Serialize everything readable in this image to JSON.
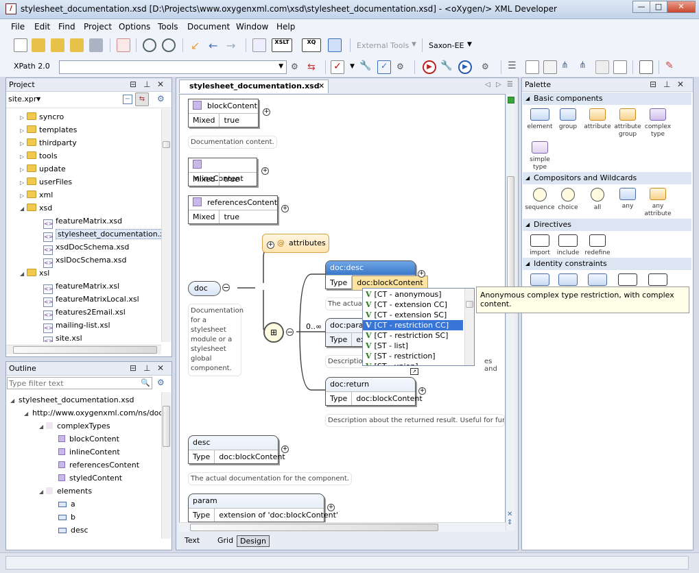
{
  "window": {
    "title": "stylesheet_documentation.xsd [D:\\Projects\\www.oxygenxml.com\\xsd\\stylesheet_documentation.xsd] - <oXygen/> XML Developer",
    "min": "—",
    "max": "□",
    "close": "✕"
  },
  "menu": [
    "File",
    "Edit",
    "Find",
    "Project",
    "Options",
    "Tools",
    "Document",
    "Window",
    "Help"
  ],
  "toolbar": {
    "external_tools": "External Tools",
    "transformer": "Saxon-EE",
    "xpath_version": "XPath 2.0",
    "xpath_value": ""
  },
  "project": {
    "title": "Project",
    "file": "site.xpr",
    "items": [
      {
        "label": "syncro",
        "kind": "folder"
      },
      {
        "label": "templates",
        "kind": "folder"
      },
      {
        "label": "thirdparty",
        "kind": "folder"
      },
      {
        "label": "tools",
        "kind": "folder"
      },
      {
        "label": "update",
        "kind": "folder"
      },
      {
        "label": "userFiles",
        "kind": "folder"
      },
      {
        "label": "xml",
        "kind": "folder"
      },
      {
        "label": "xsd",
        "kind": "folder-open"
      },
      {
        "label": "featureMatrix.xsd",
        "kind": "file"
      },
      {
        "label": "stylesheet_documentation.xsd",
        "kind": "file-selected"
      },
      {
        "label": "xsdDocSchema.xsd",
        "kind": "file"
      },
      {
        "label": "xslDocSchema.xsd",
        "kind": "file"
      },
      {
        "label": "xsl",
        "kind": "folder-open"
      },
      {
        "label": "featureMatrix.xsl",
        "kind": "file"
      },
      {
        "label": "featureMatrixLocal.xsl",
        "kind": "file"
      },
      {
        "label": "features2Email.xsl",
        "kind": "file"
      },
      {
        "label": "mailing-list.xsl",
        "kind": "file"
      },
      {
        "label": "site.xsl",
        "kind": "file"
      }
    ]
  },
  "outline": {
    "title": "Outline",
    "filter_placeholder": "Type filter text",
    "items": [
      {
        "label": "stylesheet_documentation.xsd"
      },
      {
        "label": "http://www.oxygenxml.com/ns/doc/xs"
      },
      {
        "label": "complexTypes"
      },
      {
        "label": "blockContent"
      },
      {
        "label": "inlineContent"
      },
      {
        "label": "referencesContent"
      },
      {
        "label": "styledContent"
      },
      {
        "label": "elements"
      },
      {
        "label": "a"
      },
      {
        "label": "b"
      },
      {
        "label": "desc"
      }
    ]
  },
  "editor": {
    "tab": "stylesheet_documentation.xsd",
    "nodes": {
      "block": {
        "name": "blockContent",
        "k": "Mixed",
        "v": "true",
        "doc": "Documentation content."
      },
      "inline": {
        "name": "inlineContent",
        "k": "Mixed",
        "v": "true"
      },
      "refs": {
        "name": "referencesContent",
        "k": "Mixed",
        "v": "true"
      },
      "attributes": "attributes",
      "doc": {
        "name": "doc",
        "note": "Documentation for a stylesheet module or a stylesheet global component."
      },
      "docdesc": {
        "name": "doc:desc",
        "k": "Type",
        "v": "doc:blockContent",
        "note": "The actual"
      },
      "docparam": {
        "name": "doc:param",
        "k": "Type",
        "v": "ex",
        "note": "Description",
        "note_right": "es and"
      },
      "occurs": "0..∞",
      "docreturn": {
        "name": "doc:return",
        "k": "Type",
        "v": "doc:blockContent",
        "note": "Description about the returned result. Useful for func"
      },
      "desc": {
        "name": "desc",
        "k": "Type",
        "v": "doc:blockContent",
        "note": "The actual documentation for the component."
      },
      "param": {
        "name": "param",
        "k": "Type",
        "v": "extension of 'doc:blockContent'"
      }
    },
    "autocomplete": [
      "[CT - anonymous]",
      "[CT - extension CC]",
      "[CT - extension SC]",
      "[CT - restriction CC]",
      "[CT - restriction SC]",
      "[ST - list]",
      "[ST - restriction]",
      "[ST - union]"
    ],
    "autocomplete_selected": 3,
    "tooltip": "Anonymous complex type restriction, with complex content.",
    "bottom_tabs": [
      "Text",
      "Grid",
      "Design"
    ],
    "active_bottom_tab": "Design"
  },
  "palette": {
    "title": "Palette",
    "sections": [
      {
        "name": "Basic components",
        "items": [
          "element",
          "group",
          "attribute",
          "attribute group",
          "complex type",
          "simple type"
        ]
      },
      {
        "name": "Compositors and Wildcards",
        "items": [
          "sequence",
          "choice",
          "all",
          "any",
          "any attribute"
        ]
      },
      {
        "name": "Directives",
        "items": [
          "import",
          "include",
          "redefine"
        ]
      },
      {
        "name": "Identity constraints",
        "items": []
      }
    ]
  }
}
